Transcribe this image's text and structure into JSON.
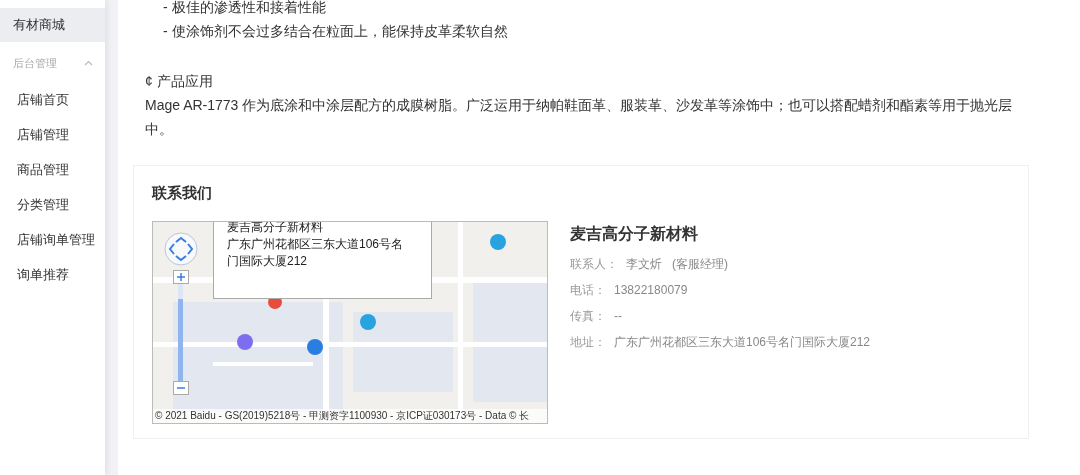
{
  "sidebar": {
    "items": [
      {
        "label": "有材商城",
        "selected": true
      }
    ],
    "group": {
      "label": "后台管理",
      "expanded": true,
      "children": [
        {
          "label": "店铺首页",
          "selected": false
        },
        {
          "label": "店铺管理",
          "selected": false
        },
        {
          "label": "商品管理",
          "selected": false
        },
        {
          "label": "分类管理",
          "selected": false
        },
        {
          "label": "店铺询单管理",
          "selected": false
        },
        {
          "label": "询单推荐",
          "selected": false
        }
      ]
    }
  },
  "content": {
    "bullets": [
      "- 极佳的渗透性和接着性能",
      "- 使涂饰剂不会过多结合在粒面上，能保持皮革柔软自然"
    ],
    "section_title": "¢ 产品应用",
    "paragraph": "Mage AR-1773 作为底涂和中涂层配方的成膜树脂。广泛运用于纳帕鞋面革、服装革、沙发革等涂饰中；也可以搭配蜡剂和酯素等用于抛光层中。"
  },
  "contact": {
    "title": "联系我们",
    "map": {
      "kind": "picture",
      "zoom": {
        "level": 0.85
      },
      "popup_lines": [
        "麦吉高分子新材料",
        "广东广州花都区三东大道106号名门国际大厦212"
      ],
      "copyright": "© 2021 Baidu - GS(2019)5218号 - 甲测资字1100930 - 京ICP证030173号 - Data © 长"
    },
    "company": "麦吉高分子新材料",
    "fields": [
      {
        "label": "联系人：",
        "value": "李文炘   (客服经理)"
      },
      {
        "label": "电话：",
        "value": "13822180079"
      },
      {
        "label": "传真：",
        "value": "--"
      },
      {
        "label": "地址：",
        "value": "广东广州花都区三东大道106号名门国际大厦212"
      }
    ]
  }
}
